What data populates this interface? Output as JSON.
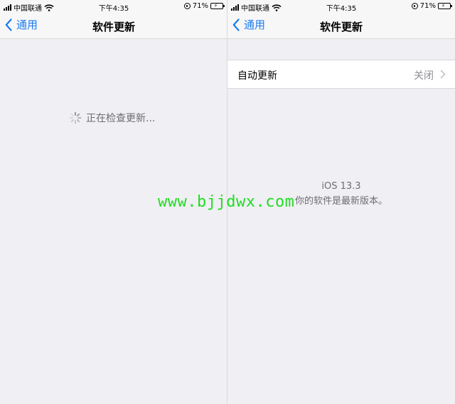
{
  "status_bar": {
    "carrier": "中国联通",
    "time": "下午4:35",
    "battery_percent": "71%",
    "battery_level": 0.71
  },
  "left_screen": {
    "back_label": "通用",
    "title": "软件更新",
    "checking_text": "正在检查更新..."
  },
  "right_screen": {
    "back_label": "通用",
    "title": "软件更新",
    "auto_update": {
      "label": "自动更新",
      "value": "关闭"
    },
    "version": "iOS 13.3",
    "status": "你的软件是最新版本。"
  },
  "watermark": "www.bjjdwx.com",
  "colors": {
    "accent": "#1a7cf0",
    "background": "#efeff4",
    "watermark": "#22dd22",
    "battery": "#34c759"
  },
  "icons": {
    "back": "chevron-left-icon",
    "spinner": "activity-spinner-icon",
    "disclosure": "chevron-right-icon",
    "wifi": "wifi-icon",
    "signal": "cellular-signal-icon",
    "rotation_lock": "orientation-lock-icon",
    "battery": "battery-charging-icon"
  }
}
